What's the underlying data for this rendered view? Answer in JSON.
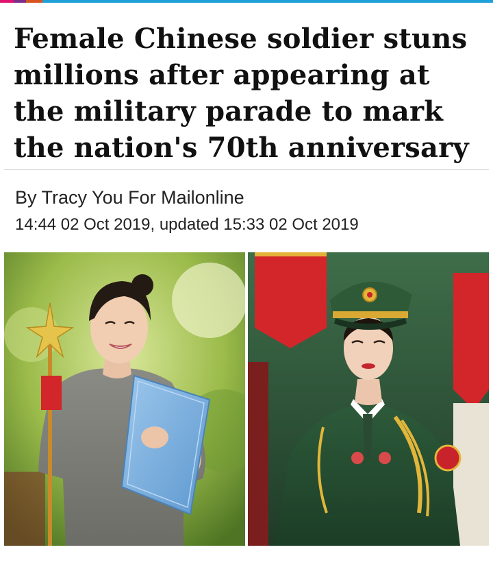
{
  "header": {
    "accent_colors": [
      "#e0126e",
      "#7b2f8a",
      "#d9531e",
      "#1fa0d8"
    ]
  },
  "article": {
    "headline": "Female Chinese soldier stuns millions after appearing at the military parade to mark the nation's 70th anniversary",
    "byline": "By Tracy You For Mailonline",
    "dateline": "14:44 02 Oct 2019, updated 15:33 02 Oct 2019"
  },
  "images": {
    "left": {
      "icon": "woman-in-grey-tshirt-holding-blue-folder-photo"
    },
    "right": {
      "icon": "female-soldier-in-dress-uniform-photo"
    }
  }
}
